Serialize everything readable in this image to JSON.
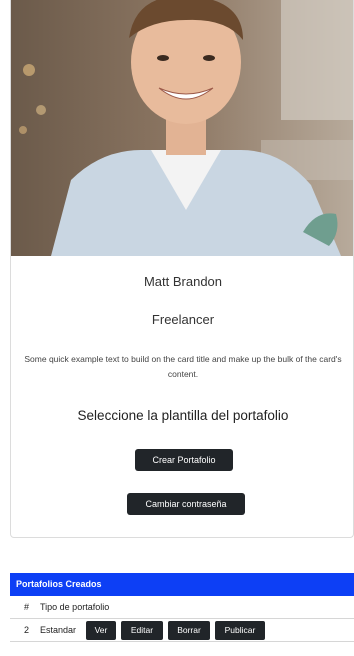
{
  "profile": {
    "name": "Matt Brandon",
    "role": "Freelancer",
    "description": "Some quick example text to build on the card title and make up the bulk of the card's content.",
    "prompt": "Seleccione la plantilla del portafolio",
    "create_label": "Crear Portafolio",
    "password_label": "Cambiar contraseña"
  },
  "portfolios": {
    "title": "Portafolios Creados",
    "columns": [
      "#",
      "Tipo de portafolio"
    ],
    "rows": [
      {
        "id": "2",
        "type": "Estandar",
        "actions": [
          "Ver",
          "Editar",
          "Borrar",
          "Publicar"
        ]
      }
    ]
  },
  "colors": {
    "header_blue": "#0d3ff5",
    "button_dark": "#212529"
  }
}
